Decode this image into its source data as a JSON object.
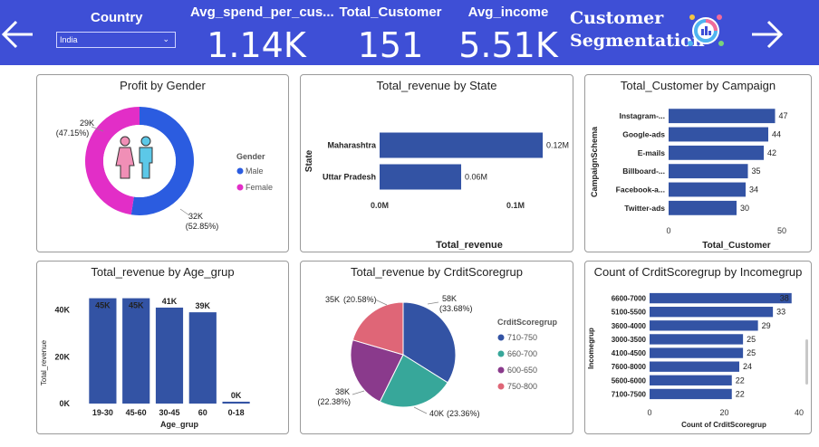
{
  "banner": {
    "country_label": "Country",
    "country_value": "India",
    "brand_line1": "Customer",
    "brand_line2": "Segmentation",
    "kpis": [
      {
        "title": "Avg_spend_per_cus...",
        "value": "1.14K"
      },
      {
        "title": "Total_Customer",
        "value": "151"
      },
      {
        "title": "Avg_income",
        "value": "5.51K"
      }
    ],
    "colors": {
      "bar": "#3e4fd6",
      "text": "#ffffff"
    }
  },
  "charts": [
    {
      "type": "pie",
      "title": "Profit by Gender",
      "legend_title": "Gender",
      "slices": [
        {
          "label": "Male",
          "value": 32,
          "data_label": "32K",
          "pct_label": "(52.85%)",
          "color": "#2b5ce0"
        },
        {
          "label": "Female",
          "value": 29,
          "data_label": "29K",
          "pct_label": "(47.15%)",
          "color": "#e22ec7"
        }
      ]
    },
    {
      "type": "bar",
      "orientation": "horizontal",
      "title": "Total_revenue by State",
      "xlabel": "Total_revenue",
      "ylabel": "State",
      "categories": [
        "Maharashtra",
        "Uttar Pradesh"
      ],
      "values": [
        0.12,
        0.06
      ],
      "data_labels": [
        "0.12M",
        "0.06M"
      ],
      "xlim": [
        0,
        0.1333
      ],
      "ticks": [
        {
          "value": 0,
          "label": "0.0M"
        },
        {
          "value": 0.1,
          "label": "0.1M"
        }
      ],
      "color": "#3353a4"
    },
    {
      "type": "bar",
      "orientation": "horizontal",
      "title": "Total_Customer by Campaign",
      "xlabel": "Total_Customer",
      "ylabel": "CampaignSchema",
      "categories": [
        "Instagram-...",
        "Google-ads",
        "E-mails",
        "Billboard-...",
        "Facebook-a...",
        "Twitter-ads"
      ],
      "values": [
        47,
        44,
        42,
        35,
        34,
        30
      ],
      "data_labels": [
        "47",
        "44",
        "42",
        "35",
        "34",
        "30"
      ],
      "xlim": [
        0,
        50
      ],
      "ticks": [
        {
          "value": 0,
          "label": "0"
        },
        {
          "value": 50,
          "label": "50"
        }
      ],
      "color": "#3353a4"
    },
    {
      "type": "bar",
      "orientation": "vertical",
      "title": "Total_revenue by Age_grup",
      "xlabel": "Age_grup",
      "ylabel": "Total_revenue",
      "categories": [
        "19-30",
        "45-60",
        "30-45",
        "60",
        "0-18"
      ],
      "values": [
        45,
        45,
        41,
        39,
        0.8
      ],
      "data_labels": [
        "45K",
        "45K",
        "41K",
        "39K",
        "0K"
      ],
      "ylim": [
        0,
        46
      ],
      "ticks": [
        {
          "value": 0,
          "label": "0K"
        },
        {
          "value": 20,
          "label": "20K"
        },
        {
          "value": 40,
          "label": "40K"
        }
      ],
      "color": "#3353a4"
    },
    {
      "type": "pie",
      "title": "Total_revenue by CrditScoregrup",
      "legend_title": "CrditScoregrup",
      "slices": [
        {
          "label": "710-750",
          "value": 58,
          "data_label": "58K",
          "pct_label": "(33.68%)",
          "color": "#3353a4"
        },
        {
          "label": "660-700",
          "value": 40,
          "data_label": "40K",
          "pct_label": "(23.36%)",
          "color": "#37a79a"
        },
        {
          "label": "600-650",
          "value": 38,
          "data_label": "38K",
          "pct_label": "(22.38%)",
          "color": "#8a3a8c"
        },
        {
          "label": "750-800",
          "value": 35,
          "data_label": "35K",
          "pct_label": "(20.58%)",
          "color": "#df6677"
        }
      ]
    },
    {
      "type": "bar",
      "orientation": "horizontal",
      "title": "Count of CrditScoregrup by Incomegrup",
      "xlabel": "Count of CrditScoregrup",
      "ylabel": "Incomegrup",
      "categories": [
        "6600-7000",
        "5100-5500",
        "3600-4000",
        "3000-3500",
        "4100-4500",
        "7600-8000",
        "5600-6000",
        "7100-7500"
      ],
      "values": [
        38,
        33,
        29,
        25,
        25,
        24,
        22,
        22
      ],
      "data_labels": [
        "38",
        "33",
        "29",
        "25",
        "25",
        "24",
        "22",
        "22"
      ],
      "xlim": [
        0,
        40
      ],
      "ticks": [
        {
          "value": 0,
          "label": "0"
        },
        {
          "value": 20,
          "label": "20"
        },
        {
          "value": 40,
          "label": "40"
        }
      ],
      "color": "#3353a4"
    }
  ]
}
